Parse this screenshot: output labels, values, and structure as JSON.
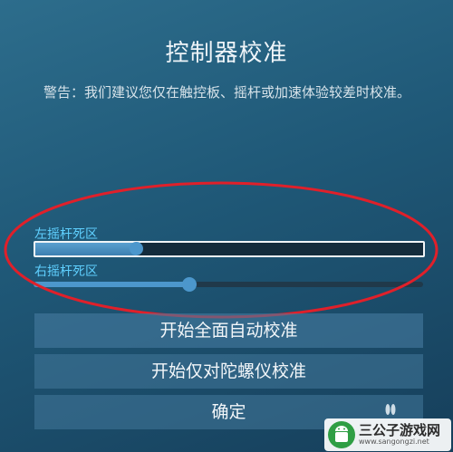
{
  "dialog": {
    "title": "控制器校准",
    "warning": "警告：我们建议您仅在触控板、摇杆或加速体验较差时校准。"
  },
  "sliders": {
    "left": {
      "label": "左摇杆死区",
      "value": 0.26
    },
    "right": {
      "label": "右摇杆死区",
      "value": 0.4
    }
  },
  "buttons": {
    "full_calibration": "开始全面自动校准",
    "gyro_calibration": "开始仅对陀螺仪校准",
    "ok": "确定"
  },
  "colors": {
    "accent": "#5fd0ff",
    "annotation": "#e0202a",
    "slider_fill": "#4c97cc"
  },
  "watermark": {
    "title": "三公子游戏网",
    "url": "www.sangongzi.net"
  }
}
